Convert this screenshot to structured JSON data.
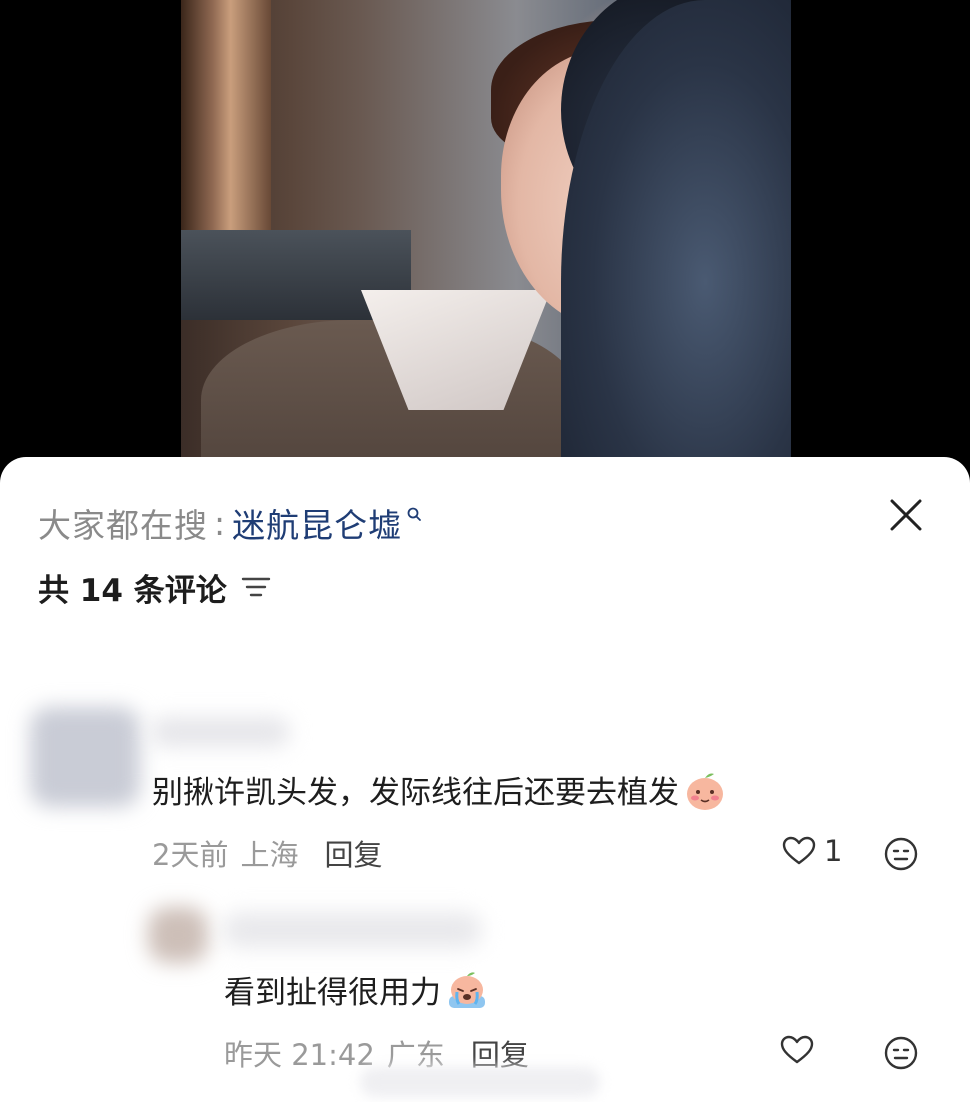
{
  "search": {
    "prefix": "大家都在搜",
    "separator": ":",
    "term": "迷航昆仑墟"
  },
  "header": {
    "count_label": "共 14 条评论"
  },
  "comments": [
    {
      "text": "别揪许凯头发，发际线往后还要去植发",
      "sticker": "peach-blush-sticker",
      "time": "2天前",
      "location": "上海",
      "reply_label": "回复",
      "likes": "1"
    },
    {
      "text": "看到扯得很用力",
      "sticker": "peach-crying-sticker",
      "time": "昨天 21:42",
      "location": "广东",
      "reply_label": "回复",
      "likes": ""
    }
  ],
  "colors": {
    "search_term": "#1f3d75",
    "muted_text": "#9a9a9a",
    "body_text": "#1e1e1e",
    "sheet_bg": "#ffffff"
  }
}
